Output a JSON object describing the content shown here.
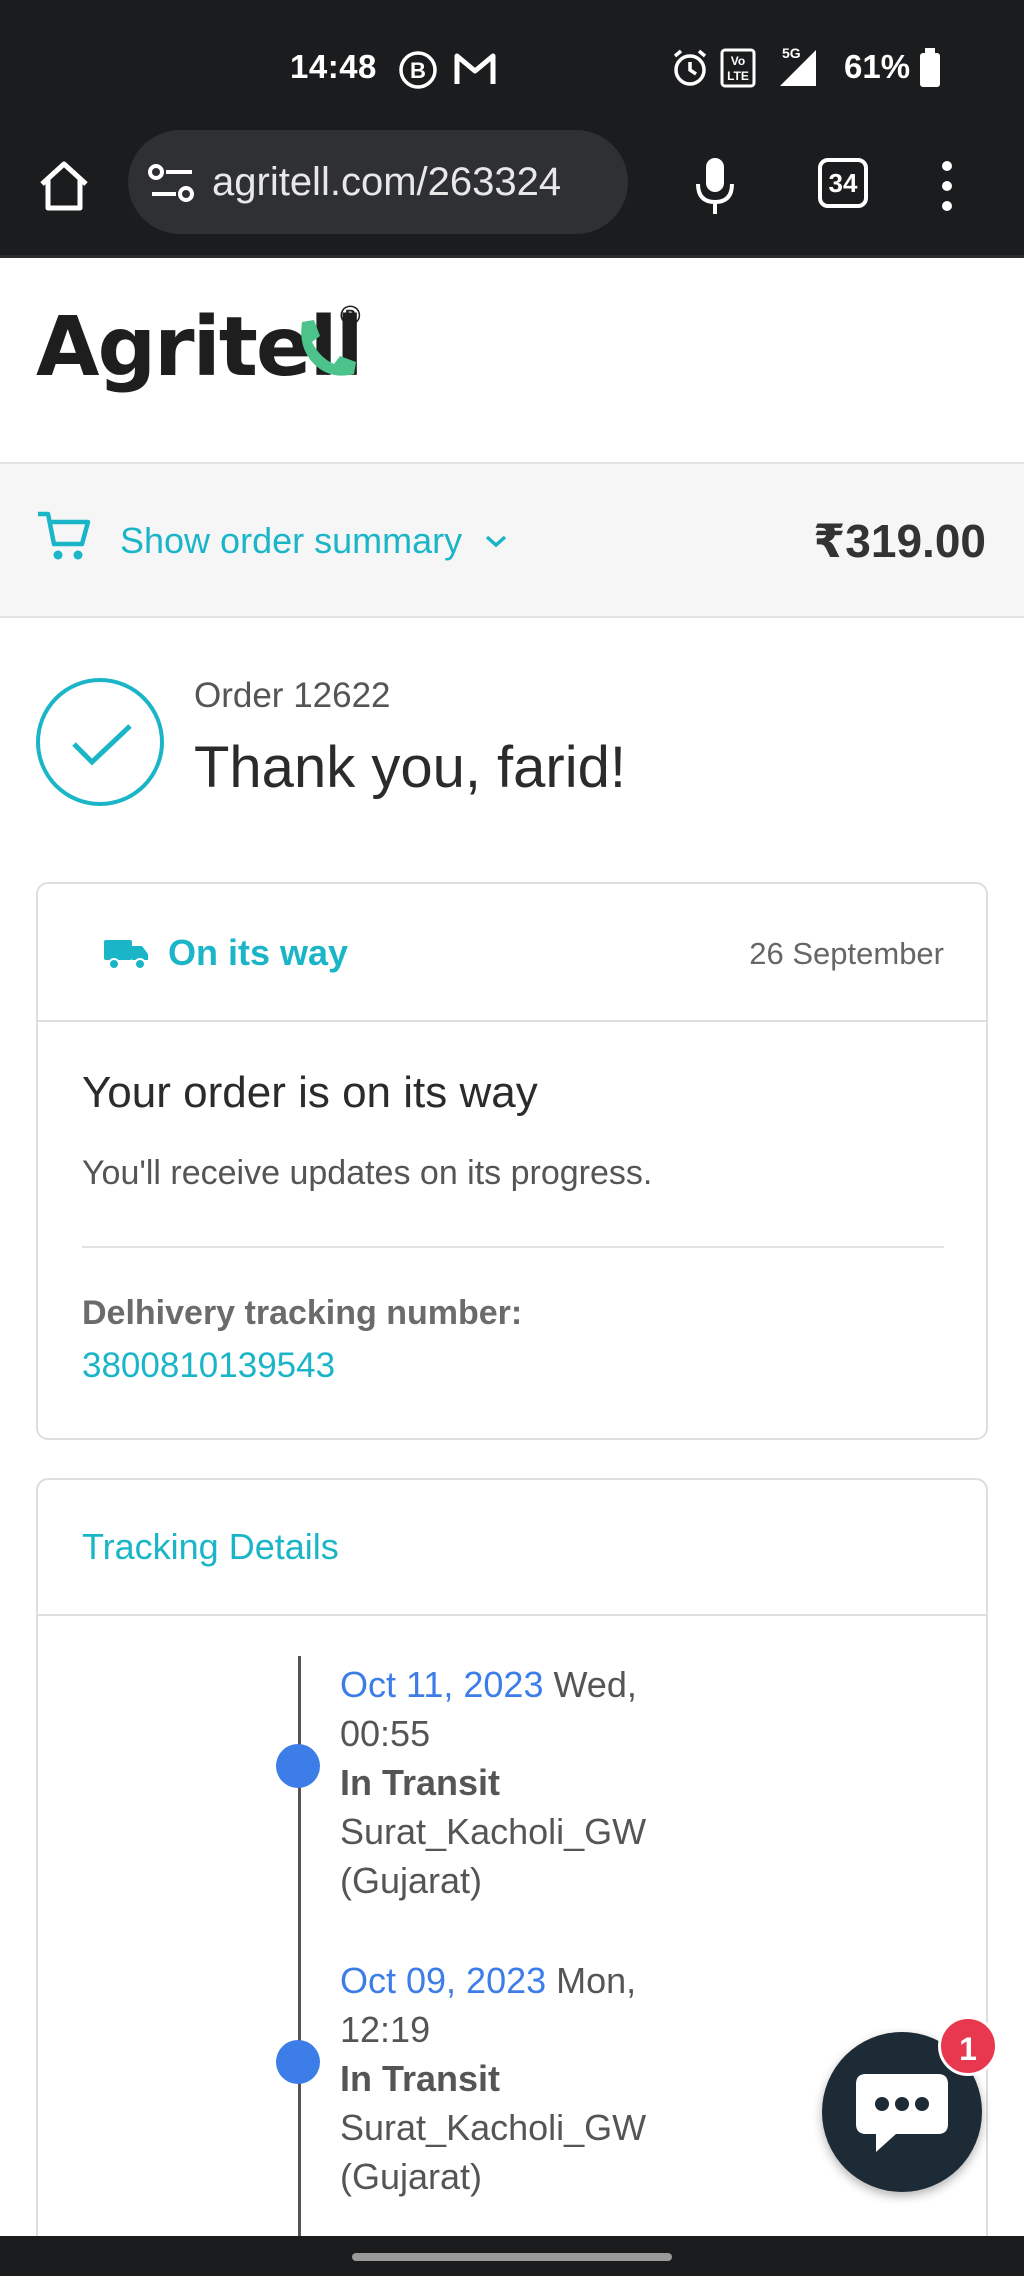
{
  "status_bar": {
    "time": "14:48",
    "battery": "61%",
    "icons": [
      "b-icon",
      "gmail-icon",
      "alarm-icon",
      "volte-icon",
      "signal-5g-icon",
      "battery-icon"
    ]
  },
  "browser": {
    "url": "agritell.com/263324",
    "tab_count": "34",
    "icons": [
      "home-icon",
      "site-settings-icon",
      "mic-icon",
      "tabs-icon",
      "more-vert-icon"
    ]
  },
  "logo": {
    "text": "Agritell",
    "registered": "®"
  },
  "summary": {
    "label": "Show order summary",
    "total": "₹319.00"
  },
  "order": {
    "number": "Order 12622",
    "thanks": "Thank you, farid!"
  },
  "shipping": {
    "status": "On its way",
    "date": "26 September",
    "title": "Your order is on its way",
    "description": "You'll receive updates on its progress.",
    "tracking_label": "Delhivery tracking number:",
    "tracking_number": "3800810139543"
  },
  "tracking": {
    "title": "Tracking Details",
    "events": [
      {
        "date": "Oct 11, 2023",
        "day": " Wed,",
        "time": "00:55",
        "status": "In Transit",
        "location1": "Surat_Kacholi_GW",
        "location2": "(Gujarat)"
      },
      {
        "date": "Oct 09, 2023",
        "day": " Mon,",
        "time": "12:19",
        "status": "In Transit",
        "location1": "Surat_Kacholi_GW",
        "location2": "(Gujarat)"
      }
    ]
  },
  "chat": {
    "badge": "1"
  },
  "colors": {
    "accent": "#1bb5c8",
    "timeline": "#3d7de8",
    "badge": "#e8384f",
    "chat": "#1d2b36"
  }
}
